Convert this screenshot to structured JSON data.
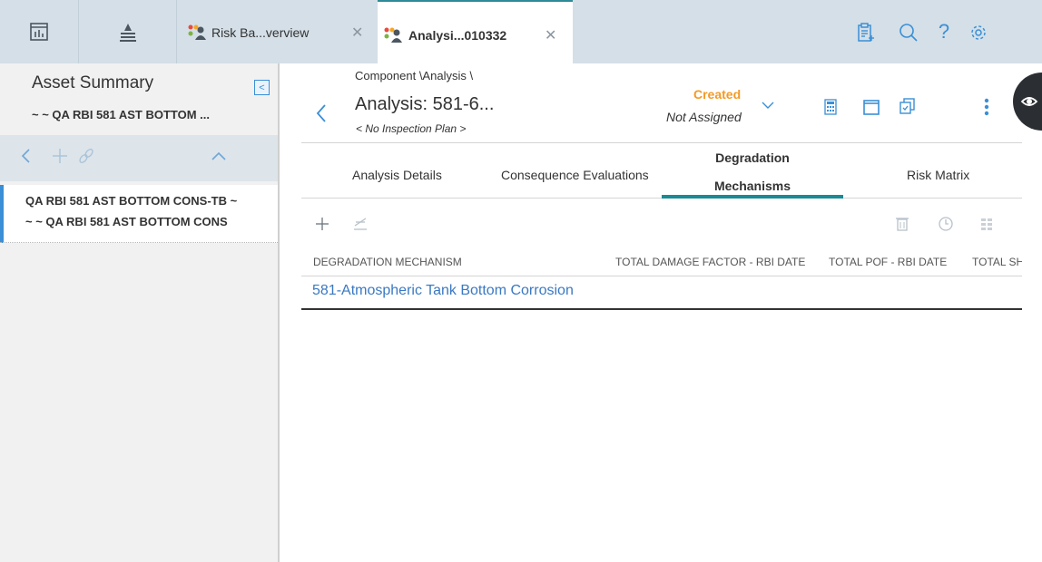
{
  "tabs": [
    {
      "label": "Risk Ba...verview"
    },
    {
      "label": "Analysi...010332"
    }
  ],
  "left_panel": {
    "title": "Asset Summary",
    "subtitle": "~ ~ QA RBI 581 AST BOTTOM ...",
    "item": {
      "line1": "QA RBI 581 AST BOTTOM CONS-TB ~",
      "line2": "~ ~ QA RBI 581 AST BOTTOM CONS"
    }
  },
  "header": {
    "breadcrumb": "Component \\Analysis \\",
    "title": "Analysis: 581-6...",
    "plan": "< No Inspection Plan >",
    "status": "Created",
    "assigned": "Not Assigned"
  },
  "section_tabs": {
    "analysis_details": "Analysis Details",
    "consequence": "Consequence Evaluations",
    "degradation_line1": "Degradation",
    "degradation_line2": "Mechanisms",
    "risk_matrix": "Risk Matrix"
  },
  "grid": {
    "columns": [
      "DEGRADATION MECHANISM",
      "TOTAL DAMAGE FACTOR - RBI DATE",
      "TOTAL POF - RBI DATE",
      "TOTAL SH"
    ],
    "rows": [
      {
        "mechanism": "581-Atmospheric Tank Bottom Corrosion"
      }
    ]
  },
  "colors": {
    "accent": "#1a8a95",
    "status": "#f39a26",
    "link": "#3a79c2",
    "selection": "#3a8fd6"
  },
  "icons": {
    "topbar": [
      "dashboard-icon",
      "hierarchy-icon",
      "users-icon",
      "close-icon",
      "clipboard-icon",
      "search-icon",
      "help-icon",
      "settings-icon"
    ],
    "header": [
      "back-icon",
      "chevron-down-icon",
      "calculator-icon",
      "window-icon",
      "copy-icon",
      "more-icon",
      "eye-icon"
    ],
    "left": [
      "collapse-icon",
      "back-icon",
      "add-icon",
      "link-icon",
      "chevron-up-icon"
    ],
    "grid": [
      "add-icon",
      "edit-icon",
      "delete-icon",
      "clock-icon",
      "grid-icon"
    ]
  }
}
